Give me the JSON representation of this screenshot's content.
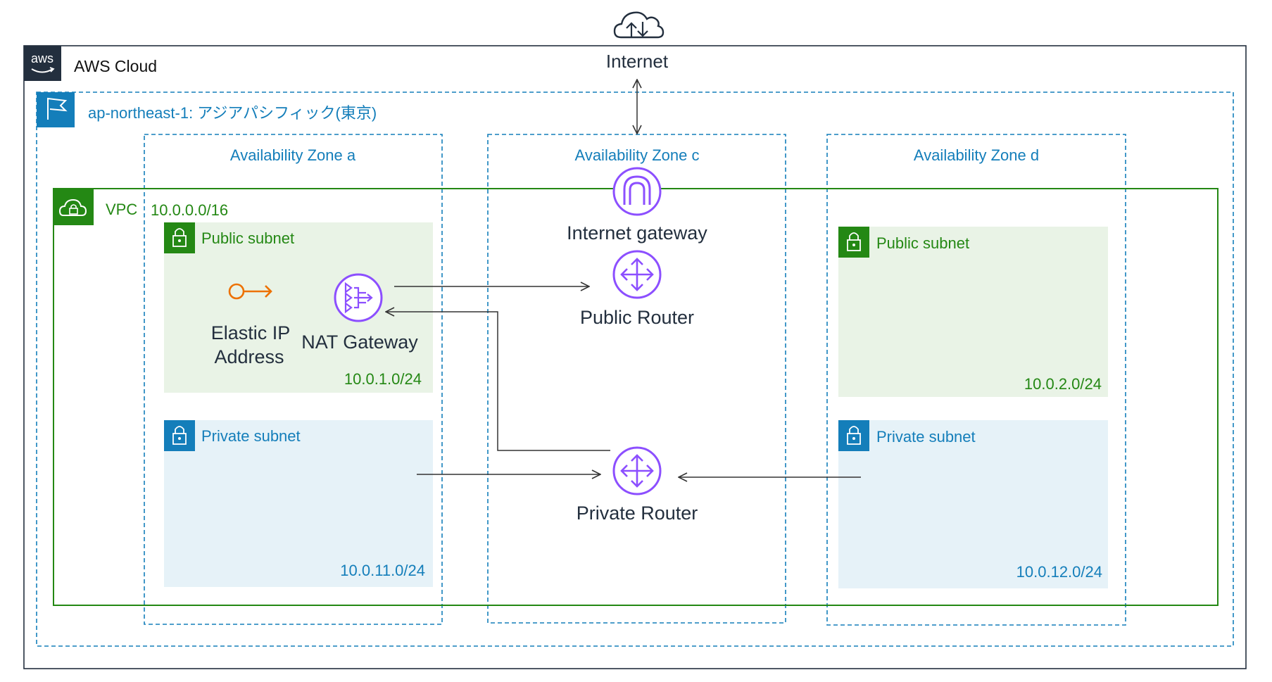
{
  "internet": {
    "label": "Internet",
    "icon": "internet-cloud-icon"
  },
  "aws_cloud": {
    "logo_text": "aws",
    "label": "AWS Cloud",
    "icon": "aws-logo"
  },
  "region": {
    "label": "ap-northeast-1: アジアパシフィック(東京)",
    "icon": "region-flag-icon",
    "color": "#147eba"
  },
  "zones": [
    {
      "label": "Availability Zone a"
    },
    {
      "label": "Availability Zone c"
    },
    {
      "label": "Availability Zone d"
    }
  ],
  "vpc": {
    "label": "VPC",
    "cidr": "10.0.0.0/16",
    "icon": "vpc-cloud-lock-icon",
    "color": "#248814"
  },
  "subnets": {
    "public_a": {
      "label": "Public subnet",
      "cidr": "10.0.1.0/24",
      "icon": "lock-icon"
    },
    "private_a": {
      "label": "Private subnet",
      "cidr": "10.0.11.0/24",
      "icon": "lock-icon"
    },
    "public_d": {
      "label": "Public subnet",
      "cidr": "10.0.2.0/24",
      "icon": "lock-icon"
    },
    "private_d": {
      "label": "Private subnet",
      "cidr": "10.0.12.0/24",
      "icon": "lock-icon"
    }
  },
  "resources": {
    "elastic_ip": {
      "label_line1": "Elastic IP",
      "label_line2": "Address",
      "icon": "elastic-ip-icon"
    },
    "nat_gateway": {
      "label": "NAT Gateway",
      "icon": "nat-gateway-icon"
    },
    "internet_gateway": {
      "label": "Internet gateway",
      "icon": "internet-gateway-icon"
    },
    "public_router": {
      "label": "Public Router",
      "icon": "router-icon"
    },
    "private_router": {
      "label": "Private Router",
      "icon": "router-icon"
    }
  },
  "colors": {
    "region_blue": "#147eba",
    "vpc_green": "#248814",
    "public_subnet_fill": "#e9f3e6",
    "private_subnet_fill": "#e6f2f8",
    "network_purple": "#8c4fff",
    "elastic_ip_orange": "#ed7100",
    "aws_dark": "#232f3e"
  }
}
